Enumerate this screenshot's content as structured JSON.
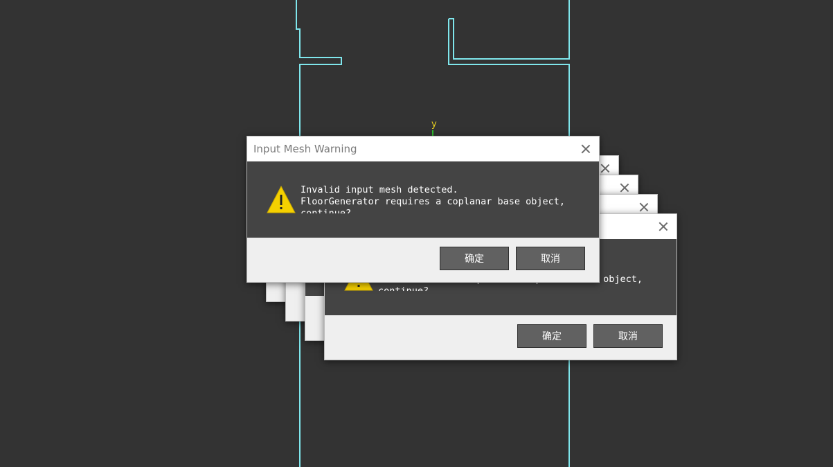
{
  "viewport": {
    "axis_label": "y",
    "outline_color": "#7fe6ec",
    "background": "#333333"
  },
  "dialog": {
    "title": "Input Mesh Warning",
    "message_lines": [
      "Invalid input mesh detected.",
      "FloorGenerator requires a coplanar base object,",
      "continue?"
    ],
    "ok_label": "确定",
    "cancel_label": "取消",
    "icon": "warning-icon",
    "close_icon": "close-icon"
  },
  "stack": {
    "stacked_dialog_count": 5,
    "front_dialog": "top-left"
  },
  "colors": {
    "message_area": "#444444",
    "footer": "#efefef",
    "button": "#616161",
    "warning_yellow": "#f5d000"
  }
}
